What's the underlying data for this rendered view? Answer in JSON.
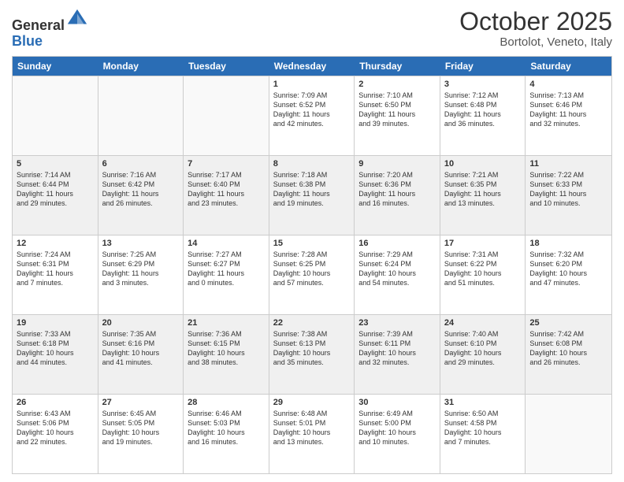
{
  "header": {
    "logo_line1": "General",
    "logo_line2": "Blue",
    "main_title": "October 2025",
    "subtitle": "Bortolot, Veneto, Italy"
  },
  "calendar": {
    "weekdays": [
      "Sunday",
      "Monday",
      "Tuesday",
      "Wednesday",
      "Thursday",
      "Friday",
      "Saturday"
    ],
    "rows": [
      [
        {
          "day": "",
          "info": ""
        },
        {
          "day": "",
          "info": ""
        },
        {
          "day": "",
          "info": ""
        },
        {
          "day": "1",
          "info": "Sunrise: 7:09 AM\nSunset: 6:52 PM\nDaylight: 11 hours\nand 42 minutes."
        },
        {
          "day": "2",
          "info": "Sunrise: 7:10 AM\nSunset: 6:50 PM\nDaylight: 11 hours\nand 39 minutes."
        },
        {
          "day": "3",
          "info": "Sunrise: 7:12 AM\nSunset: 6:48 PM\nDaylight: 11 hours\nand 36 minutes."
        },
        {
          "day": "4",
          "info": "Sunrise: 7:13 AM\nSunset: 6:46 PM\nDaylight: 11 hours\nand 32 minutes."
        }
      ],
      [
        {
          "day": "5",
          "info": "Sunrise: 7:14 AM\nSunset: 6:44 PM\nDaylight: 11 hours\nand 29 minutes."
        },
        {
          "day": "6",
          "info": "Sunrise: 7:16 AM\nSunset: 6:42 PM\nDaylight: 11 hours\nand 26 minutes."
        },
        {
          "day": "7",
          "info": "Sunrise: 7:17 AM\nSunset: 6:40 PM\nDaylight: 11 hours\nand 23 minutes."
        },
        {
          "day": "8",
          "info": "Sunrise: 7:18 AM\nSunset: 6:38 PM\nDaylight: 11 hours\nand 19 minutes."
        },
        {
          "day": "9",
          "info": "Sunrise: 7:20 AM\nSunset: 6:36 PM\nDaylight: 11 hours\nand 16 minutes."
        },
        {
          "day": "10",
          "info": "Sunrise: 7:21 AM\nSunset: 6:35 PM\nDaylight: 11 hours\nand 13 minutes."
        },
        {
          "day": "11",
          "info": "Sunrise: 7:22 AM\nSunset: 6:33 PM\nDaylight: 11 hours\nand 10 minutes."
        }
      ],
      [
        {
          "day": "12",
          "info": "Sunrise: 7:24 AM\nSunset: 6:31 PM\nDaylight: 11 hours\nand 7 minutes."
        },
        {
          "day": "13",
          "info": "Sunrise: 7:25 AM\nSunset: 6:29 PM\nDaylight: 11 hours\nand 3 minutes."
        },
        {
          "day": "14",
          "info": "Sunrise: 7:27 AM\nSunset: 6:27 PM\nDaylight: 11 hours\nand 0 minutes."
        },
        {
          "day": "15",
          "info": "Sunrise: 7:28 AM\nSunset: 6:25 PM\nDaylight: 10 hours\nand 57 minutes."
        },
        {
          "day": "16",
          "info": "Sunrise: 7:29 AM\nSunset: 6:24 PM\nDaylight: 10 hours\nand 54 minutes."
        },
        {
          "day": "17",
          "info": "Sunrise: 7:31 AM\nSunset: 6:22 PM\nDaylight: 10 hours\nand 51 minutes."
        },
        {
          "day": "18",
          "info": "Sunrise: 7:32 AM\nSunset: 6:20 PM\nDaylight: 10 hours\nand 47 minutes."
        }
      ],
      [
        {
          "day": "19",
          "info": "Sunrise: 7:33 AM\nSunset: 6:18 PM\nDaylight: 10 hours\nand 44 minutes."
        },
        {
          "day": "20",
          "info": "Sunrise: 7:35 AM\nSunset: 6:16 PM\nDaylight: 10 hours\nand 41 minutes."
        },
        {
          "day": "21",
          "info": "Sunrise: 7:36 AM\nSunset: 6:15 PM\nDaylight: 10 hours\nand 38 minutes."
        },
        {
          "day": "22",
          "info": "Sunrise: 7:38 AM\nSunset: 6:13 PM\nDaylight: 10 hours\nand 35 minutes."
        },
        {
          "day": "23",
          "info": "Sunrise: 7:39 AM\nSunset: 6:11 PM\nDaylight: 10 hours\nand 32 minutes."
        },
        {
          "day": "24",
          "info": "Sunrise: 7:40 AM\nSunset: 6:10 PM\nDaylight: 10 hours\nand 29 minutes."
        },
        {
          "day": "25",
          "info": "Sunrise: 7:42 AM\nSunset: 6:08 PM\nDaylight: 10 hours\nand 26 minutes."
        }
      ],
      [
        {
          "day": "26",
          "info": "Sunrise: 6:43 AM\nSunset: 5:06 PM\nDaylight: 10 hours\nand 22 minutes."
        },
        {
          "day": "27",
          "info": "Sunrise: 6:45 AM\nSunset: 5:05 PM\nDaylight: 10 hours\nand 19 minutes."
        },
        {
          "day": "28",
          "info": "Sunrise: 6:46 AM\nSunset: 5:03 PM\nDaylight: 10 hours\nand 16 minutes."
        },
        {
          "day": "29",
          "info": "Sunrise: 6:48 AM\nSunset: 5:01 PM\nDaylight: 10 hours\nand 13 minutes."
        },
        {
          "day": "30",
          "info": "Sunrise: 6:49 AM\nSunset: 5:00 PM\nDaylight: 10 hours\nand 10 minutes."
        },
        {
          "day": "31",
          "info": "Sunrise: 6:50 AM\nSunset: 4:58 PM\nDaylight: 10 hours\nand 7 minutes."
        },
        {
          "day": "",
          "info": ""
        }
      ]
    ]
  }
}
